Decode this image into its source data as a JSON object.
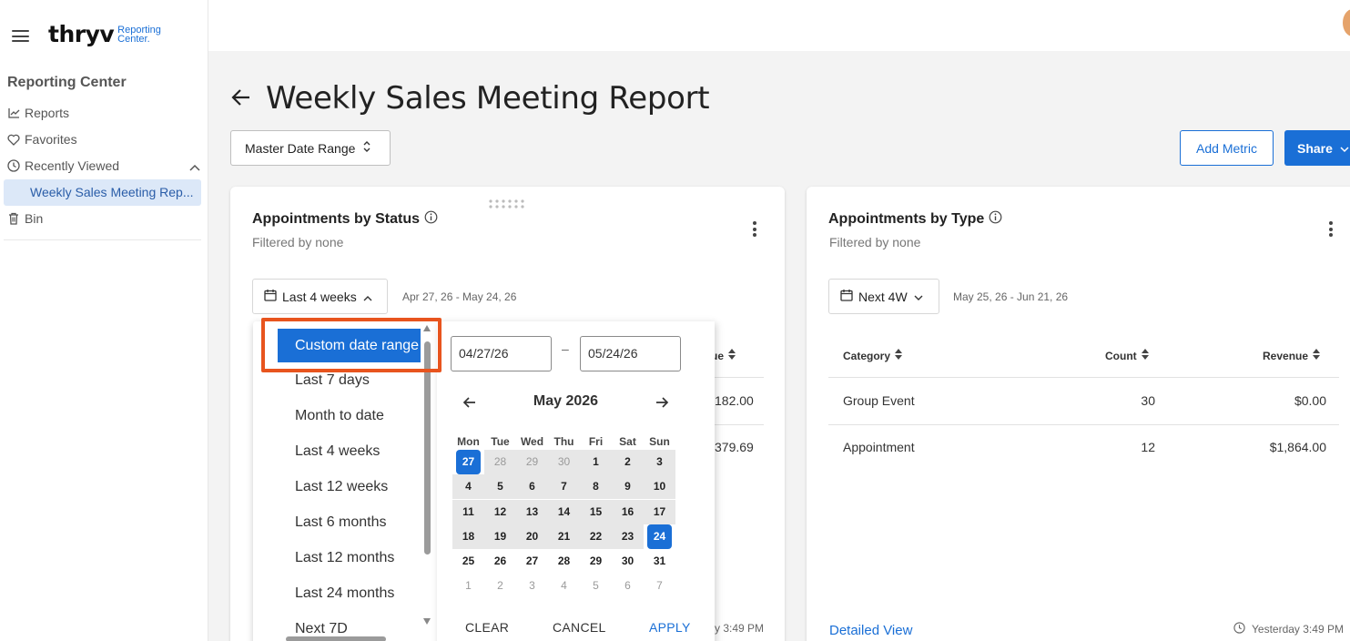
{
  "app": {
    "logo_main": "thryv",
    "logo_sub_1": "Reporting",
    "logo_sub_2": "Center."
  },
  "sidebar": {
    "heading": "Reporting Center",
    "items": [
      {
        "label": "Reports",
        "icon": "chart-line-icon"
      },
      {
        "label": "Favorites",
        "icon": "heart-icon"
      },
      {
        "label": "Recently Viewed",
        "icon": "clock-icon"
      },
      {
        "label": "Weekly Sales Meeting Rep...",
        "icon": ""
      },
      {
        "label": "Bin",
        "icon": "trash-icon"
      }
    ]
  },
  "page": {
    "title": "Weekly Sales Meeting Report",
    "master_date_range": "Master Date Range",
    "add_metric": "Add Metric",
    "share": "Share"
  },
  "card_status": {
    "title": "Appointments by Status",
    "subtitle": "Filtered by none",
    "range_label": "Last 4 weeks",
    "range_text": "Apr 27, 26 - May 24, 26",
    "col_partial": "ue",
    "values": [
      "182.00",
      "379.69"
    ],
    "updated_partial": "y 3:49 PM"
  },
  "card_type": {
    "title": "Appointments by Type",
    "subtitle": "Filtered by none",
    "range_label": "Next 4W",
    "range_text": "May 25, 26 - Jun 21, 26",
    "columns": [
      "Category",
      "Count",
      "Revenue"
    ],
    "rows": [
      {
        "category": "Group Event",
        "count": "30",
        "revenue": "$0.00"
      },
      {
        "category": "Appointment",
        "count": "12",
        "revenue": "$1,864.00"
      }
    ],
    "detailed_view": "Detailed View",
    "updated": "Yesterday 3:49 PM"
  },
  "range_dropdown": {
    "selected": "Custom date range",
    "options": [
      "Last 7 days",
      "Month to date",
      "Last 4 weeks",
      "Last 12 weeks",
      "Last 6 months",
      "Last 12 months",
      "Last 24 months",
      "Next 7D"
    ]
  },
  "calendar": {
    "start_date": "04/27/26",
    "end_date": "05/24/26",
    "dash": "–",
    "month": "May 2026",
    "weekdays": [
      "Mon",
      "Tue",
      "Wed",
      "Thu",
      "Fri",
      "Sat",
      "Sun"
    ],
    "weeks": [
      [
        "27",
        "28",
        "29",
        "30",
        "1",
        "2",
        "3"
      ],
      [
        "4",
        "5",
        "6",
        "7",
        "8",
        "9",
        "10"
      ],
      [
        "11",
        "12",
        "13",
        "14",
        "15",
        "16",
        "17"
      ],
      [
        "18",
        "19",
        "20",
        "21",
        "22",
        "23",
        "24"
      ],
      [
        "25",
        "26",
        "27",
        "28",
        "29",
        "30",
        "31"
      ],
      [
        "1",
        "2",
        "3",
        "4",
        "5",
        "6",
        "7"
      ]
    ],
    "clear": "CLEAR",
    "cancel": "CANCEL",
    "apply": "APPLY"
  },
  "colors": {
    "accent": "#1a6fd6",
    "highlight": "#e8541e",
    "range_bg": "#e7e7e7"
  }
}
